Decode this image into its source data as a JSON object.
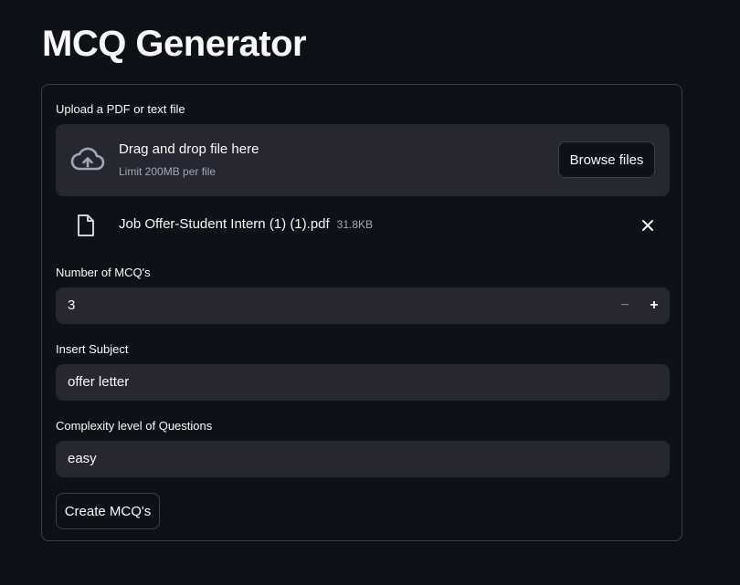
{
  "page": {
    "title": "MCQ Generator"
  },
  "uploader": {
    "label": "Upload a PDF or text file",
    "drop_text": "Drag and drop file here",
    "limit_text": "Limit 200MB per file",
    "browse_label": "Browse files",
    "file": {
      "name": "Job Offer-Student Intern (1) (1).pdf",
      "size": "31.8KB"
    }
  },
  "num_mcq": {
    "label": "Number of MCQ's",
    "value": "3",
    "minus": "−",
    "plus": "+"
  },
  "subject": {
    "label": "Insert Subject",
    "value": "offer letter"
  },
  "complexity": {
    "label": "Complexity level of Questions",
    "value": "easy"
  },
  "submit": {
    "label": "Create MCQ's"
  },
  "colors": {
    "background": "#0e1117",
    "widget_bg": "#262730",
    "text": "#fafafa",
    "muted": "#a3a8b8"
  }
}
